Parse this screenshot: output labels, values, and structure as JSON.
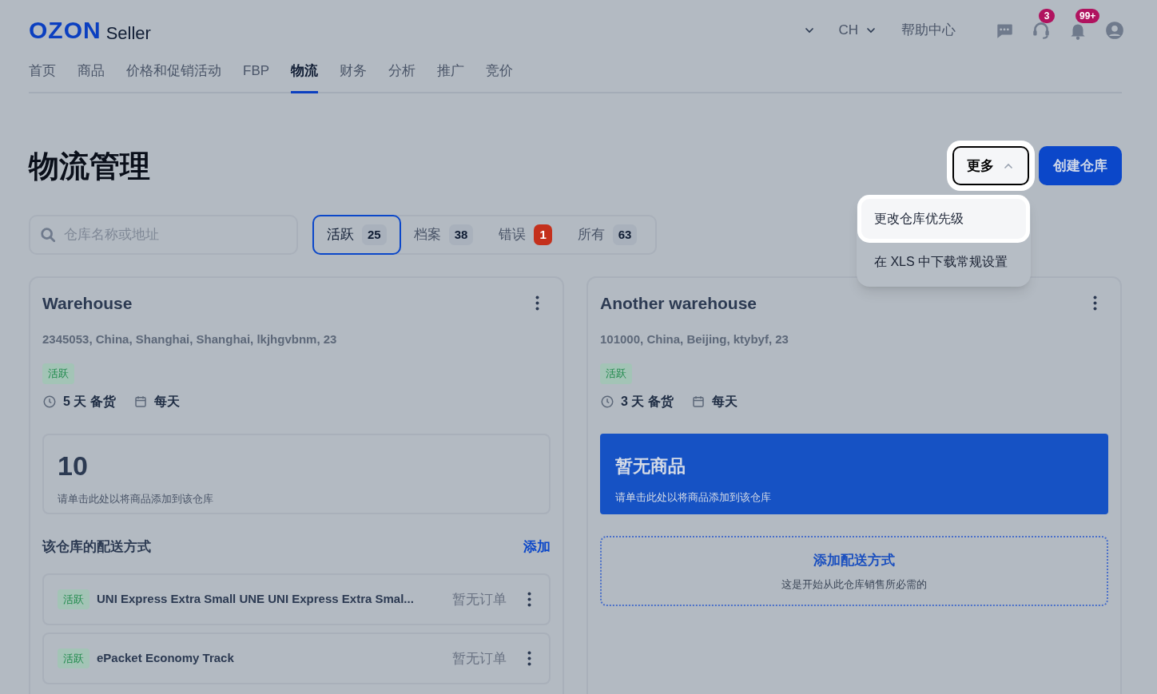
{
  "logo": {
    "brand": "OZON",
    "product": "Seller"
  },
  "header": {
    "language": "CH",
    "help": "帮助中心",
    "icons": [
      {
        "kind": "chat"
      },
      {
        "kind": "support",
        "badge": "3"
      },
      {
        "kind": "bell",
        "badge": "99+"
      },
      {
        "kind": "profile"
      }
    ]
  },
  "nav": [
    {
      "label": "首页",
      "selected": false
    },
    {
      "label": "商品",
      "selected": false
    },
    {
      "label": "价格和促销活动",
      "selected": false
    },
    {
      "label": "FBP",
      "selected": false
    },
    {
      "label": "物流",
      "selected": true
    },
    {
      "label": "财务",
      "selected": false
    },
    {
      "label": "分析",
      "selected": false
    },
    {
      "label": "推广",
      "selected": false
    },
    {
      "label": "竞价",
      "selected": false
    }
  ],
  "title": "物流管理",
  "more_button": {
    "label": "更多",
    "expanded": true
  },
  "create_button": "创建仓库",
  "menu": [
    {
      "label": "更改仓库优先级",
      "highlighted": true
    },
    {
      "label": "在 XLS 中下载常规设置",
      "highlighted": false
    }
  ],
  "search": {
    "placeholder": "仓库名称或地址"
  },
  "filters": [
    {
      "label": "活跃",
      "count": "25",
      "kind": "count",
      "selected": true
    },
    {
      "label": "档案",
      "count": "38",
      "kind": "count",
      "selected": false
    },
    {
      "label": "错误",
      "count": "1",
      "kind": "error",
      "selected": false
    },
    {
      "label": "所有",
      "count": "63",
      "kind": "count",
      "selected": false
    }
  ],
  "warehouses": [
    {
      "name": "Warehouse",
      "address": "2345053, China, Shanghai, Shanghai, lkjhgvbnm, 23",
      "status": "活跃",
      "prep": "5 天 备货",
      "schedule": "每天",
      "stock": {
        "kind": "count",
        "value": "10",
        "hint": "请单击此处以将商品添加到该仓库"
      },
      "delivery": {
        "kind": "list",
        "title": "该仓库的配送方式",
        "add_link": "添加",
        "methods": [
          {
            "status": "活跃",
            "name": "UNI Express Extra Small UNE UNI Express Extra Smal...",
            "orders": "暂无订单"
          },
          {
            "status": "活跃",
            "name": "ePacket Economy Track",
            "orders": "暂无订单"
          }
        ]
      }
    },
    {
      "name": "Another warehouse",
      "address": "101000, China, Beijing, ktybyf, 23",
      "status": "活跃",
      "prep": "3 天 备货",
      "schedule": "每天",
      "stock": {
        "kind": "empty",
        "value": "暂无商品",
        "hint": "请单击此处以将商品添加到该仓库"
      },
      "delivery": {
        "kind": "empty",
        "title": "添加配送方式",
        "hint": "这是开始从此仓库销售所必需的"
      }
    }
  ]
}
